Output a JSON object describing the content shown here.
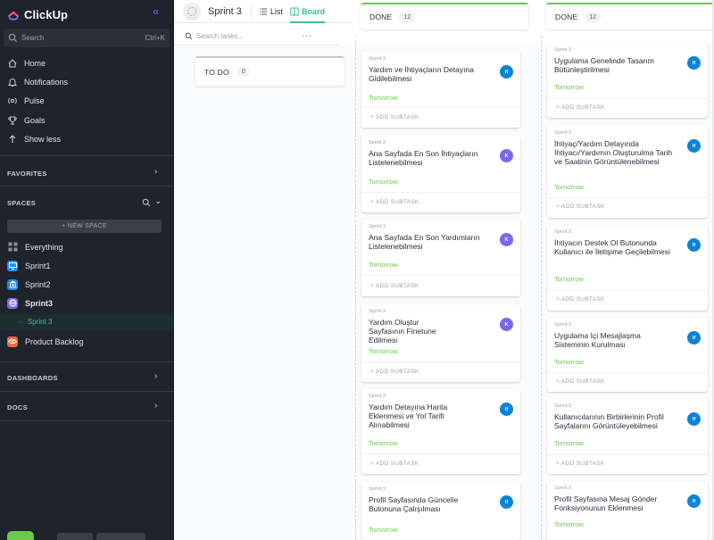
{
  "app": {
    "name": "ClickUp",
    "collapse_icon": "double-chevron-left-icon"
  },
  "search": {
    "placeholder": "Search",
    "shortcut": "Ctrl+K"
  },
  "nav": [
    {
      "label": "Home",
      "icon": "home-icon"
    },
    {
      "label": "Notifications",
      "icon": "bell-icon"
    },
    {
      "label": "Pulse",
      "icon": "pulse-icon"
    },
    {
      "label": "Goals",
      "icon": "trophy-icon"
    },
    {
      "label": "Show less",
      "icon": "arrow-up-icon"
    }
  ],
  "sections": {
    "favorites": "FAVORITES",
    "spaces": "SPACES",
    "dashboards": "DASHBOARDS",
    "docs": "DOCS"
  },
  "new_space": "+ NEW SPACE",
  "spaces": [
    {
      "label": "Everything",
      "color": "#5f6470"
    },
    {
      "label": "Sprint1",
      "color": "#1e90ff"
    },
    {
      "label": "Sprint2",
      "color": "#1e88e5"
    },
    {
      "label": "Sprint3",
      "color": "#7b68ee"
    },
    {
      "label": "Product Backlog",
      "color": "#e8683a"
    }
  ],
  "sub_list": "Sprint 3",
  "header": {
    "title": "Sprint 3",
    "tab_list": "List",
    "tab_board": "Board"
  },
  "task_search": {
    "placeholder": "Search tasks...",
    "more": "···"
  },
  "columns": {
    "todo": {
      "name": "TO DO",
      "count": "0"
    },
    "done1": {
      "name": "DONE",
      "count": "12"
    },
    "done2": {
      "name": "DONE",
      "count": "12"
    }
  },
  "cards_left": [
    {
      "list": "Sprint 3",
      "title": "Yardım ve İhtiyaçların Detayına Gidilebilmesi",
      "due": "Tomorrow",
      "subtask": "+ ADD SUBTASK",
      "avatar": "lf",
      "avatar_color": "#0a84d6"
    },
    {
      "list": "Sprint 3",
      "title": "Ana Sayfada En Son İhtiyaçların Listelenebilmesi",
      "due": "Tomorrow",
      "subtask": "+ ADD SUBTASK",
      "avatar": "K",
      "avatar_color": "#7b68ee"
    },
    {
      "list": "Sprint 3",
      "title": "Ana Sayfada En Son Yardımların Listelenebilmesi",
      "due": "Tomorrow",
      "subtask": "+ ADD SUBTASK",
      "avatar": "K",
      "avatar_color": "#7b68ee"
    },
    {
      "list": "Sprint 3",
      "title": "Yardım Oluştur Sayfasının Finetune Edilmesi",
      "due": "Tomorrow",
      "subtask": "+ ADD SUBTASK",
      "avatar": "K",
      "avatar_color": "#7b68ee"
    },
    {
      "list": "Sprint 3",
      "title": "Yardım Detayına Harita Eklenmesi ve Yol Tarifi Alınabilmesi",
      "due": "Tomorrow",
      "subtask": "+ ADD SUBTASK",
      "avatar": "lf",
      "avatar_color": "#0a84d6"
    },
    {
      "list": "Sprint 3",
      "title": "Profil Sayfasında Güncelle Butonuna Çalışılması",
      "due": "Tomorrow",
      "subtask": "",
      "avatar": "lf",
      "avatar_color": "#0a84d6"
    }
  ],
  "cards_right": [
    {
      "list": "Sprint 3",
      "title": "Uygulama Genelinde Tasarım Bütünleştirilmesi",
      "due": "Tomorrow",
      "subtask": "+ ADD SUBTASK",
      "avatar": "lf",
      "avatar_color": "#0a84d6"
    },
    {
      "list": "Sprint 3",
      "title": "İhtiyaç/Yardım Detayında İhtiyacı/Yardımın Oluşturulma Tarih ve Saatinin Görüntülenebilmesi",
      "due": "Tomorrow",
      "subtask": "+ ADD SUBTASK",
      "avatar": "lf",
      "avatar_color": "#0a84d6"
    },
    {
      "list": "Sprint 3",
      "title": "İhtiyacın Destek Ol Butonunda Kullanıcı ile İletişime Geçilebilmesi",
      "due": "Tomorrow",
      "subtask": "+ ADD SUBTASK",
      "avatar": "lf",
      "avatar_color": "#0a84d6"
    },
    {
      "list": "Sprint 3",
      "title": "Uygulama İçi Mesajlaşma Sisteminin Kurulması",
      "due": "Tomorrow",
      "subtask": "+ ADD SUBTASK",
      "avatar": "lf",
      "avatar_color": "#0a84d6"
    },
    {
      "list": "Sprint 3",
      "title": "Kullanıcılarının Birbirlerinin Profil Sayfalarını Görüntüleyebilmesi",
      "due": "Tomorrow",
      "subtask": "+ ADD SUBTASK",
      "avatar": "lf",
      "avatar_color": "#0a84d6"
    },
    {
      "list": "Sprint 3",
      "title": "Profil Sayfasına Mesaj Gönder Fonksiyonunun Eklenmesi",
      "due": "Tomorrow",
      "subtask": "",
      "avatar": "lf",
      "avatar_color": "#0a84d6"
    }
  ]
}
